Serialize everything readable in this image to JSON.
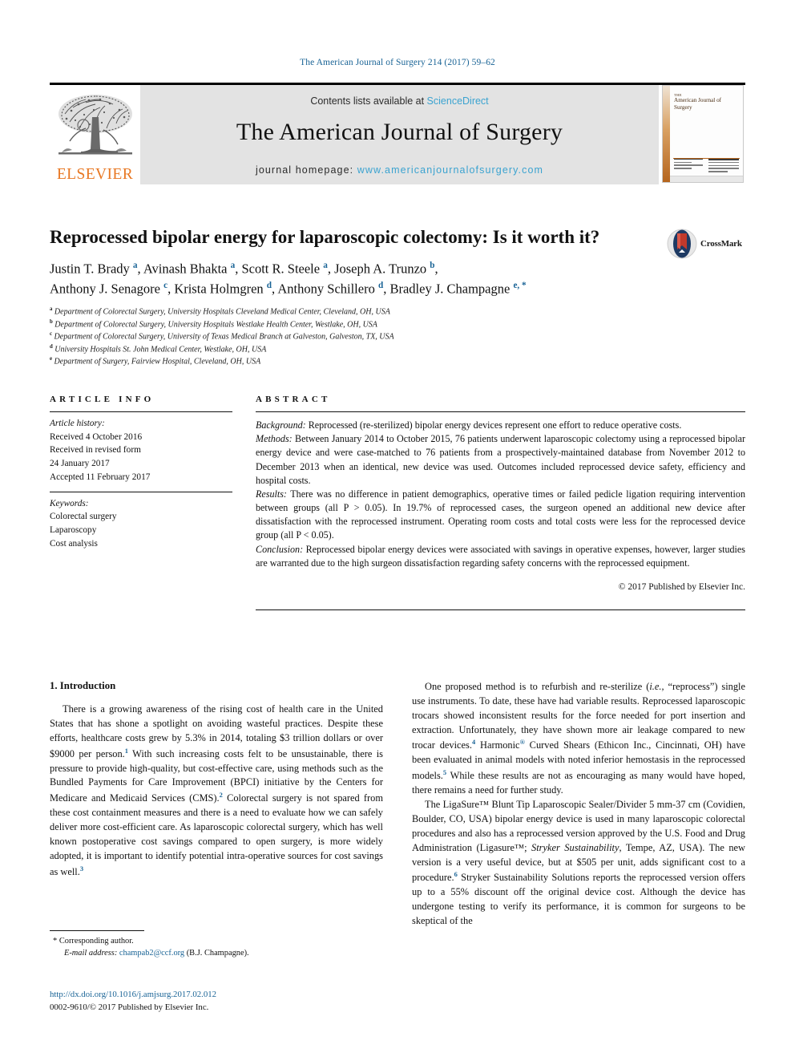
{
  "running_head": "The American Journal of Surgery 214 (2017) 59–62",
  "masthead": {
    "contents_prefix": "Contents lists available at ",
    "sciencedirect": "ScienceDirect",
    "journal_title": "The American Journal of Surgery",
    "homepage_prefix": "journal homepage: ",
    "homepage_url": "www.americanjournalofsurgery.com",
    "publisher": "ELSEVIER",
    "cover_title_the": "THE",
    "cover_title_main": "American Journal of Surgery",
    "colors": {
      "link": "#3ba3d0",
      "elsevier_orange": "#e87722",
      "band_gray": "#e3e3e3",
      "running_head_blue": "#1a6496"
    }
  },
  "article": {
    "title": "Reprocessed bipolar energy for laparoscopic colectomy: Is it worth it?",
    "crossmark_label": "CrossMark",
    "authors_line_1": "Justin T. Brady <sup>a</sup>, Avinash Bhakta <sup>a</sup>, Scott R. Steele <sup>a</sup>, Joseph A. Trunzo <sup>b</sup>,",
    "authors_line_2": "Anthony J. Senagore <sup>c</sup>, Krista Holmgren <sup>d</sup>, Anthony Schillero <sup>d</sup>, Bradley J. Champagne <sup>e, *</sup>",
    "affiliations": [
      "<sup>a</sup> Department of Colorectal Surgery, University Hospitals Cleveland Medical Center, Cleveland, OH, USA",
      "<sup>b</sup> Department of Colorectal Surgery, University Hospitals Westlake Health Center, Westlake, OH, USA",
      "<sup>c</sup> Department of Colorectal Surgery, University of Texas Medical Branch at Galveston, Galveston, TX, USA",
      "<sup>d</sup> University Hospitals St. John Medical Center, Westlake, OH, USA",
      "<sup>e</sup> Department of Surgery, Fairview Hospital, Cleveland, OH, USA"
    ]
  },
  "article_info": {
    "heading": "ARTICLE INFO",
    "history_label": "Article history:",
    "history_lines": [
      "Received 4 October 2016",
      "Received in revised form",
      "24 January 2017",
      "Accepted 11 February 2017"
    ],
    "keywords_label": "Keywords:",
    "keywords": [
      "Colorectal surgery",
      "Laparoscopy",
      "Cost analysis"
    ]
  },
  "abstract": {
    "heading": "ABSTRACT",
    "sections": [
      {
        "label": "Background:",
        "text": " Reprocessed (re-sterilized) bipolar energy devices represent one effort to reduce operative costs."
      },
      {
        "label": "Methods:",
        "text": " Between January 2014 to October 2015, 76 patients underwent laparoscopic colectomy using a reprocessed bipolar energy device and were case-matched to 76 patients from a prospectively-maintained database from November 2012 to December 2013 when an identical, new device was used. Outcomes included reprocessed device safety, efficiency and hospital costs."
      },
      {
        "label": "Results:",
        "text": " There was no difference in patient demographics, operative times or failed pedicle ligation requiring intervention between groups (all P > 0.05). In 19.7% of reprocessed cases, the surgeon opened an additional new device after dissatisfaction with the reprocessed instrument. Operating room costs and total costs were less for the reprocessed device group (all P < 0.05)."
      },
      {
        "label": "Conclusion:",
        "text": " Reprocessed bipolar energy devices were associated with savings in operative expenses, however, larger studies are warranted due to the high surgeon dissatisfaction regarding safety concerns with the reprocessed equipment."
      }
    ],
    "copyright": "© 2017 Published by Elsevier Inc."
  },
  "body": {
    "section_number_title": "1. Introduction",
    "left_paragraphs": [
      "There is a growing awareness of the rising cost of health care in the United States that has shone a spotlight on avoiding wasteful practices. Despite these efforts, healthcare costs grew by 5.3% in 2014, totaling $3 trillion dollars or over $9000 per person.<sup>1</sup> With such increasing costs felt to be unsustainable, there is pressure to provide high-quality, but cost-effective care, using methods such as the Bundled Payments for Care Improvement (BPCI) initiative by the Centers for Medicare and Medicaid Services (CMS).<sup>2</sup> Colorectal surgery is not spared from these cost containment measures and there is a need to evaluate how we can safely deliver more cost-efficient care. As laparoscopic colorectal surgery, which has well known postoperative cost savings compared to open surgery, is more widely adopted, it is important to identify potential intra-operative sources for cost savings as well.<sup>3</sup>"
    ],
    "right_paragraphs": [
      "One proposed method is to refurbish and re-sterilize (<i>i.e.,</i> “reprocess”) single use instruments. To date, these have had variable results. Reprocessed laparoscopic trocars showed inconsistent results for the force needed for port insertion and extraction. Unfortunately, they have shown more air leakage compared to new trocar devices.<sup>4</sup> Harmonic<sup>®</sup> Curved Shears (Ethicon Inc., Cincinnati, OH) have been evaluated in animal models with noted inferior hemostasis in the reprocessed models.<sup>5</sup> While these results are not as encouraging as many would have hoped, there remains a need for further study.",
      "The LigaSure™ Blunt Tip Laparoscopic Sealer/Divider 5 mm-37 cm (Covidien, Boulder, CO, USA) bipolar energy device is used in many laparoscopic colorectal procedures and also has a reprocessed version approved by the U.S. Food and Drug Administration (Ligasure™; <i>Stryker Sustainability</i>, Tempe, AZ, USA). The new version is a very useful device, but at $505 per unit, adds significant cost to a procedure.<sup>6</sup> Stryker Sustainability Solutions reports the reprocessed version offers up to a 55% discount off the original device cost. Although the device has undergone testing to verify its performance, it is common for surgeons to be skeptical of the"
    ]
  },
  "footer": {
    "corresponding_marker": "*",
    "corresponding_author": "Corresponding author.",
    "email_label": "E-mail address:",
    "email": "champab2@ccf.org",
    "email_suffix": "(B.J. Champagne).",
    "doi_url": "http://dx.doi.org/10.1016/j.amjsurg.2017.02.012",
    "issn_line": "0002-9610/© 2017 Published by Elsevier Inc."
  }
}
